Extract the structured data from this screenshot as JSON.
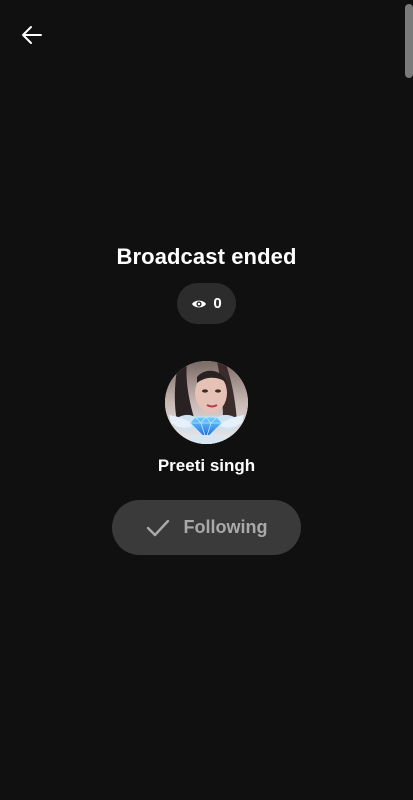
{
  "header": {
    "back_icon": "arrow-left-icon"
  },
  "broadcast": {
    "title": "Broadcast ended",
    "viewers_icon": "eye-icon",
    "viewer_count": "0"
  },
  "host": {
    "name": "Preeti singh",
    "follow_icon": "checkmark-icon",
    "follow_label": "Following"
  },
  "colors": {
    "background": "#101010",
    "pill": "#2c2c2c",
    "button": "#3a3a3a",
    "button_text": "#a9a9a9",
    "text": "#ffffff"
  }
}
